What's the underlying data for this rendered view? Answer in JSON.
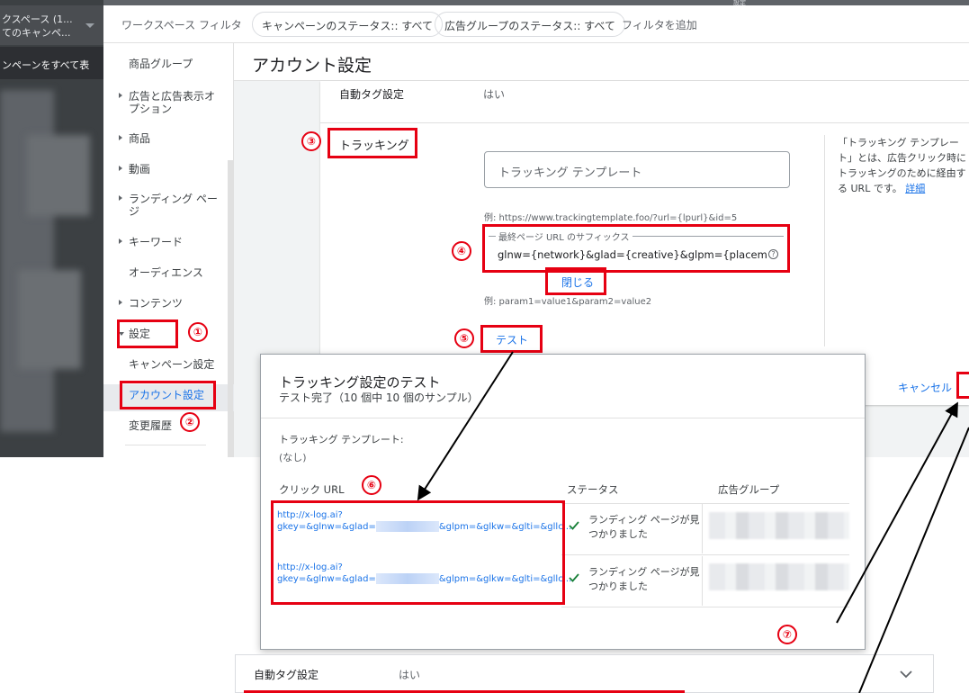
{
  "nav": {
    "workspace_line1": "クスペース (1...",
    "workspace_line2": "てのキャンペ...",
    "all_campaigns": "ンペーンをすべて表",
    "top_label": "設定"
  },
  "filterbar": {
    "label": "ワークスペース フィルタ",
    "chips": [
      "キャンペーンのステータス:: すべて",
      "広告グループのステータス:: すべて"
    ],
    "add_filter": "フィルタを追加"
  },
  "subnav": {
    "items": [
      "商品グループ",
      "広告と広告表示オプション",
      "商品",
      "動画",
      "ランディング ページ",
      "キーワード",
      "オーディエンス",
      "コンテンツ",
      "設定",
      "キャンペーン設定",
      "アカウント設定",
      "変更履歴"
    ],
    "items_wrapped": {
      "ads_line1": "広告と広告表示オ",
      "ads_line2": "プション",
      "lp_line1": "ランディング ペー",
      "lp_line2": "ジ"
    }
  },
  "main": {
    "title": "アカウント設定",
    "autotag_label": "自動タグ設定",
    "autotag_value": "はい",
    "tracking_title": "トラッキング",
    "template_placeholder": "トラッキング テンプレート",
    "template_example": "例: https://www.trackingtemplate.foo/?url={lpurl}&id=5",
    "suffix_legend": "最終ページ URL のサフィックス",
    "suffix_value": "glnw={network}&glad={creative}&glpm={placement}&glkw",
    "suffix_example": "例: param1=value1&param2=value2",
    "test_button": "テスト",
    "help_line1": "「トラッキング テンプレー",
    "help_line2": "ト」とは、広告クリック時に",
    "help_line3": "トラッキングのために経由す",
    "help_line4": "る URL です。",
    "help_link": "詳細",
    "cancel": "キャンセル"
  },
  "dialog": {
    "title": "トラッキング設定のテスト",
    "subtitle": "テスト完了（10 個中 10 個のサンプル）",
    "template_label": "トラッキング テンプレート:",
    "template_value": "(なし)",
    "col_url": "クリック URL",
    "col_status": "ステータス",
    "col_adgroup": "広告グループ",
    "rows": [
      {
        "url1": "http://x-log.ai?",
        "url2a": "gkey=&glnw=&glad=",
        "url2b": "&glpm=&glkw=&glti=&gllc...",
        "status": "ランディング ページが見つかりました"
      },
      {
        "url1": "http://x-log.ai?",
        "url2a": "gkey=&glnw=&glad=",
        "url2b": "&glpm=&glkw=&glti=&gllc...",
        "status": "ランディング ページが見つかりました"
      }
    ],
    "close": "閉じる"
  },
  "bottombar": {
    "label": "自動タグ設定",
    "value": "はい"
  },
  "markers": [
    "①",
    "②",
    "③",
    "④",
    "⑤",
    "⑥",
    "⑦"
  ],
  "colors": {
    "annotation_red": "#e60012",
    "link_blue": "#1a73e8",
    "nav_dark": "#3c4043"
  }
}
